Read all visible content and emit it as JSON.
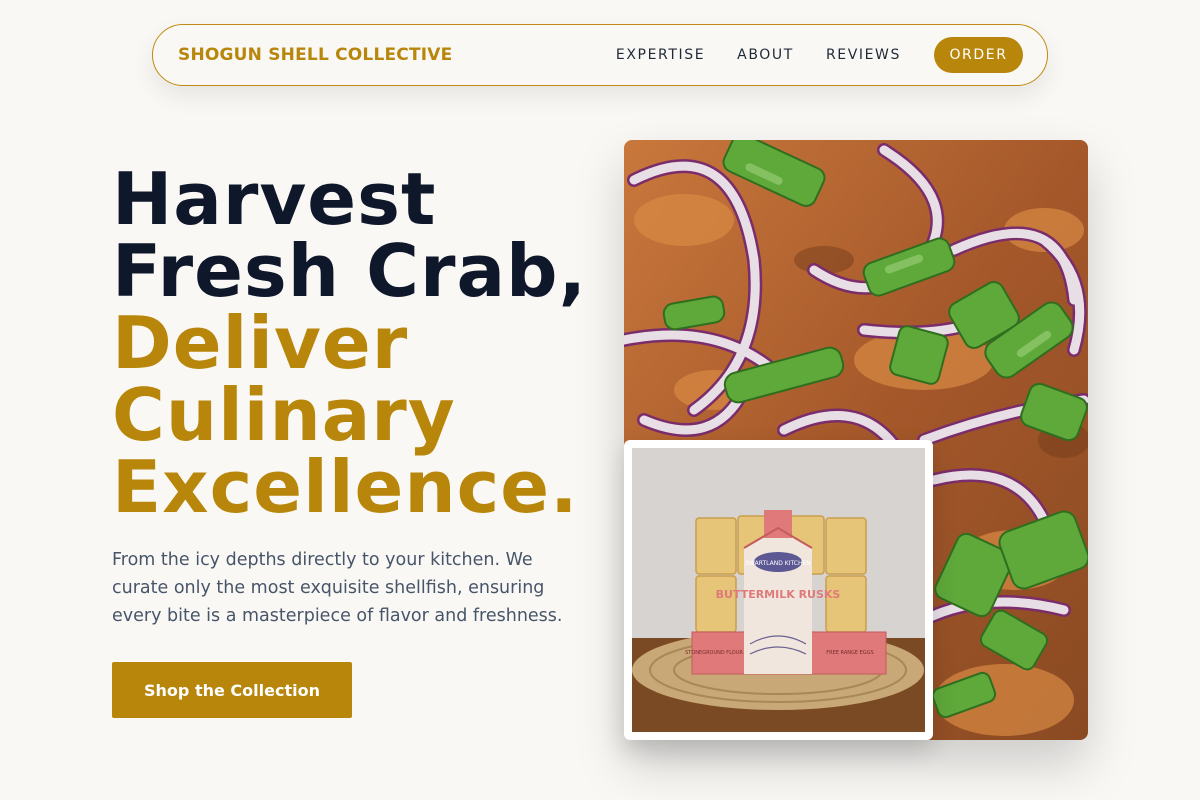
{
  "nav": {
    "brand": "SHOGUN SHELL COLLECTIVE",
    "links": [
      "EXPERTISE",
      "ABOUT",
      "REVIEWS"
    ],
    "order_label": "ORDER"
  },
  "hero": {
    "title_dark": [
      "Harvest",
      "Fresh Crab,"
    ],
    "title_gold": [
      "Deliver",
      "Culinary",
      "Excellence."
    ],
    "description": "From the icy depths directly to your kitchen. We curate only the most exquisite shellfish, ensuring every bite is a masterpiece of flavor and freshness.",
    "cta_label": "Shop the Collection"
  },
  "images": {
    "main": {
      "alt": "Crab dish topped with red onion and green onion"
    },
    "secondary": {
      "alt": "Packaged buttermilk rusks on a woven mat",
      "package_brand": "SWARTLAND KITCHEN",
      "package_name": "BUTTERMILK RUSKS",
      "package_left": "STONEGROUND FLOUR",
      "package_right": "FREE RANGE EGGS"
    }
  },
  "colors": {
    "accent": "#b8860b",
    "heading": "#0f172a",
    "body_text": "#475569",
    "background": "#faf8f5"
  }
}
